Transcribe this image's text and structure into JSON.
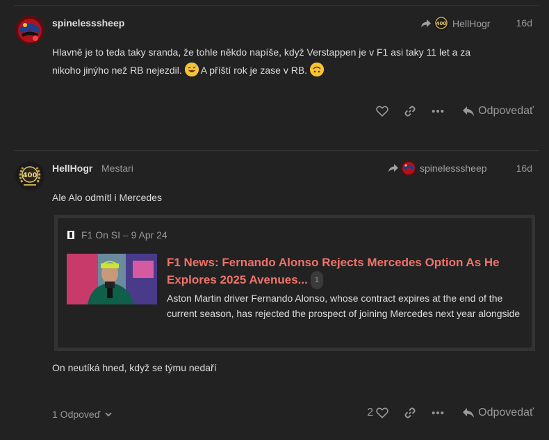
{
  "posts": [
    {
      "username": "spinelesssheep",
      "reply_to_user": "HellHogr",
      "age": "16d",
      "body_line1": "Hlavně je to teda taky sranda, že tohle někdo napíše, když Verstappen je v F1 asi taky 11 let a za",
      "body_line2": "nikoho jinýho než RB nejezdil.",
      "body_line2b": "A příští rok je zase v RB.",
      "reply_label": "Odpovedať"
    },
    {
      "username": "HellHogr",
      "user_title": "Mestari",
      "reply_to_user": "spinelesssheep",
      "age": "16d",
      "body_intro": "Ale Alo odmítl i Mercedes",
      "onebox": {
        "source": "F1 On SI – 9 Apr 24",
        "title_line1": "F1 News: Fernando Alonso Rejects Mercedes Option As He",
        "title_line2": "Explores 2025 Avenues...",
        "click_count": "1",
        "description": "Aston Martin driver Fernando Alonso, whose contract expires at the end of the current season, has rejected the prospect of joining Mercedes next year alongside"
      },
      "body_outro": "On neutíká hned, když se týmu nedaří",
      "replies_toggle": "1 Odpoveď",
      "like_count": "2",
      "reply_label": "Odpovedať"
    }
  ],
  "avatar_badge": "400",
  "icons": {
    "like": "heart-icon",
    "link": "link-icon",
    "more": "ellipsis-icon",
    "reply": "reply-arrow-icon",
    "reply_to": "share-arrow-icon",
    "expand": "chevron-down-icon"
  },
  "colors": {
    "background": "#222222",
    "text": "#dddddd",
    "muted": "#999999",
    "onebox_title": "#f0736b",
    "border": "#333333"
  }
}
